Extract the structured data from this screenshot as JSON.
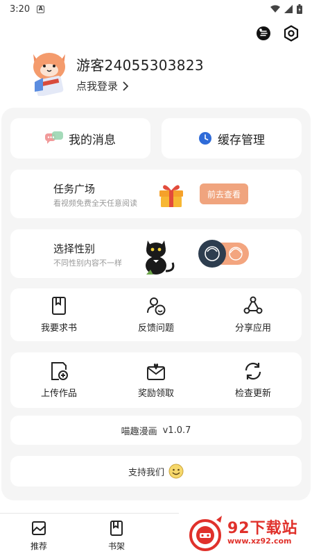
{
  "status_bar": {
    "time": "3:20",
    "notification_badge": "A"
  },
  "top_icons": [
    "theme-mode-icon",
    "settings-icon"
  ],
  "profile": {
    "username": "游客24055303823",
    "login_prompt": "点我登录"
  },
  "quick_actions": {
    "messages": "我的消息",
    "cache": "缓存管理"
  },
  "task_square": {
    "title": "任务广场",
    "subtitle": "看视频免费全天任意阅读",
    "button": "前去查看"
  },
  "gender_select": {
    "title": "选择性别",
    "subtitle": "不同性别内容不一样"
  },
  "grid_row_1": [
    {
      "label": "我要求书",
      "icon": "book-icon"
    },
    {
      "label": "反馈问题",
      "icon": "feedback-icon"
    },
    {
      "label": "分享应用",
      "icon": "share-icon"
    }
  ],
  "grid_row_2": [
    {
      "label": "上传作品",
      "icon": "upload-icon"
    },
    {
      "label": "奖励领取",
      "icon": "reward-mail-icon"
    },
    {
      "label": "检查更新",
      "icon": "refresh-icon"
    }
  ],
  "version": {
    "app_name": "喵趣漫画",
    "number": "v1.0.7"
  },
  "support": {
    "label": "支持我们"
  },
  "tabs": [
    {
      "label": "推荐",
      "icon": "recommend-icon"
    },
    {
      "label": "书架",
      "icon": "bookshelf-icon"
    }
  ],
  "watermark": {
    "title": "92下载站",
    "url": "www.xz92.com"
  },
  "colors": {
    "accent_orange": "#f0a47e",
    "watermark_red": "#e0312b",
    "panel_bg": "#f5f5f5"
  }
}
